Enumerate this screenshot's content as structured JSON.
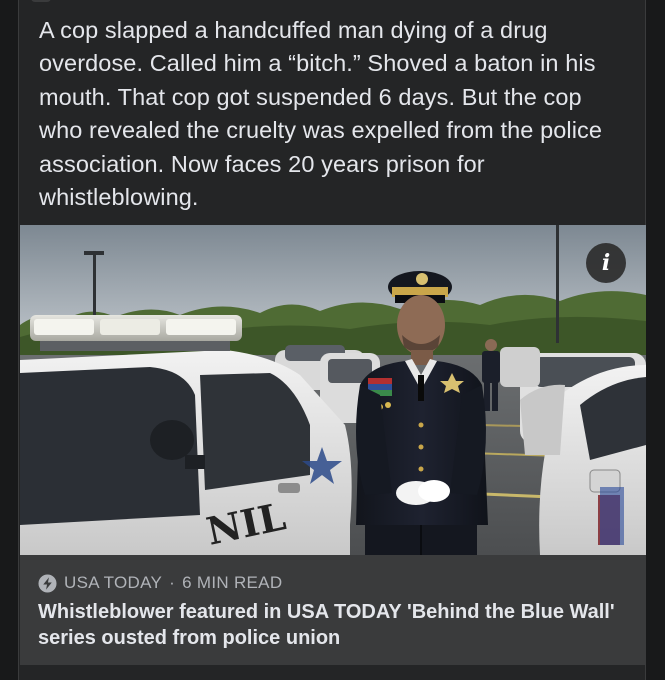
{
  "post": {
    "text": "A cop slapped a handcuffed man dying of a drug overdose. Called him a “bitch.” Shoved a baton in his mouth. That cop got suspended 6 days. But the cop who revealed the cruelty was expelled from the police association. Now faces 20 years prison for whistleblowing."
  },
  "media": {
    "image_icon": "police-officer-photo",
    "info_label": "i"
  },
  "link_preview": {
    "source_icon": "lightning-bolt-icon",
    "source": "USA TODAY",
    "separator": "·",
    "read_time": "6 MIN READ",
    "title": "Whistleblower featured in USA TODAY 'Behind the Blue Wall' series ousted from police union"
  },
  "colors": {
    "page_background": "#18191a",
    "card_background": "#242526",
    "preview_background": "#3a3b3c",
    "primary_text": "#e4e6eb",
    "secondary_text": "#b0b3b8"
  }
}
